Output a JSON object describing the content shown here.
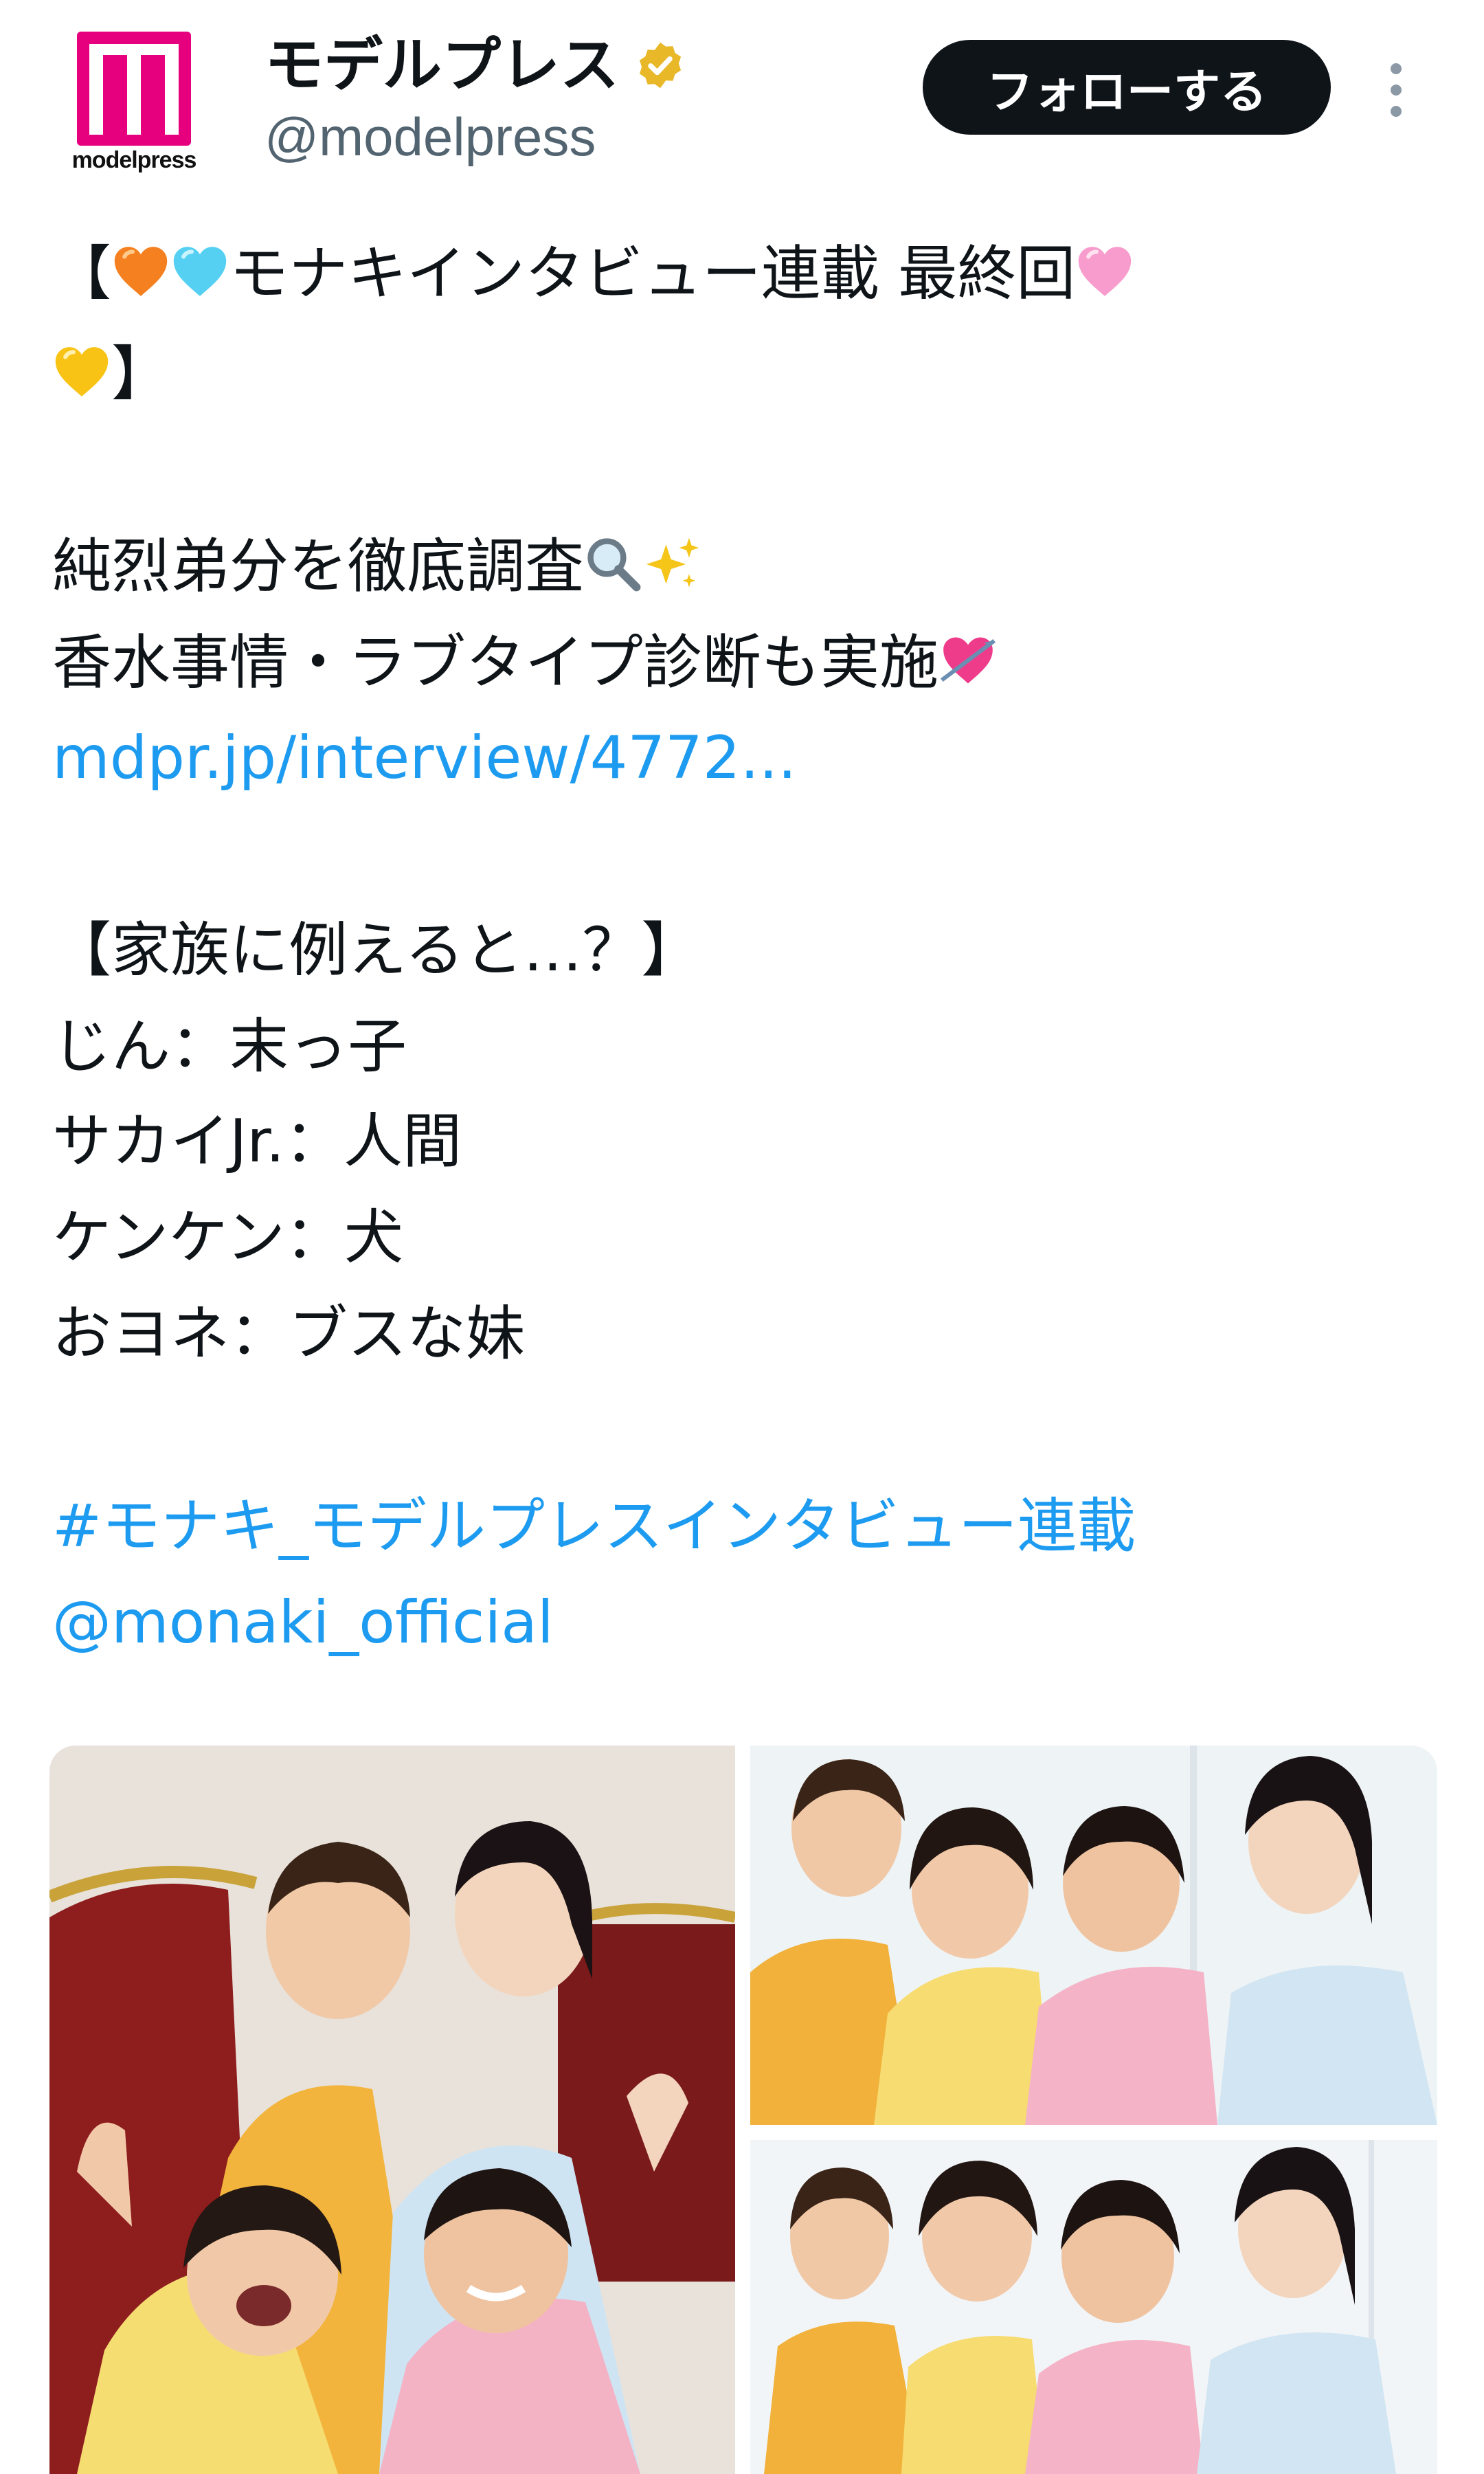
{
  "account": {
    "logo_text": "modelpress",
    "display_name": "モデルプレス",
    "handle": "@modelpress",
    "verified": true,
    "verified_color": "#e8b829",
    "brand_color": "#e6007e"
  },
  "actions": {
    "follow_label": "フォローする",
    "more_icon": "more-vertical-icon"
  },
  "tweet": {
    "line1": {
      "open": "【",
      "text": "モナキインタビュー連載 最終回",
      "emojis": [
        "orange-heart",
        "light-blue-heart",
        "pink-heart"
      ]
    },
    "line2": {
      "close": "】",
      "emojis": [
        "yellow-heart"
      ]
    },
    "line3": {
      "text": "純烈弟分を徹底調査",
      "emojis": [
        "magnifier",
        "sparkles"
      ]
    },
    "line4": {
      "text": "香水事情・ラブタイプ診断も実施",
      "emojis": [
        "heart-with-arrow"
      ]
    },
    "link": "mdpr.jp/interview/4772...",
    "section_title": "【家族に例えると…？】",
    "family": [
      "じん：末っ子",
      "サカイJr.：人間",
      "ケンケン：犬",
      "おヨネ：ブスな妹"
    ],
    "hashtag": "#モナキ_モデルプレスインタビュー連載",
    "mention": "@monaki_official"
  },
  "media": {
    "count": 3,
    "items": [
      "group-photo-on-sofa",
      "group-photo-row",
      "group-photo-row-2"
    ]
  },
  "colors": {
    "text": "#0f1419",
    "secondary": "#536471",
    "link": "#1d9bf0",
    "follow_bg": "#0f1419"
  }
}
